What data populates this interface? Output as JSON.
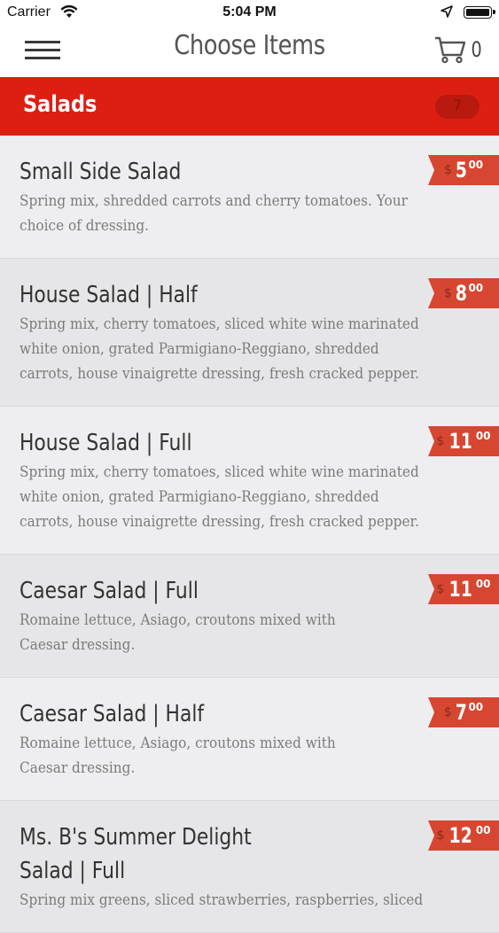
{
  "status": {
    "carrier": "Carrier",
    "time": "5:04 PM"
  },
  "nav": {
    "title": "Choose Items",
    "cart_count": "0"
  },
  "category": {
    "title": "Salads",
    "count": "7"
  },
  "currency": "$",
  "items": [
    {
      "name": "Small Side Salad",
      "desc": "Spring mix, shredded carrots and cherry tomatoes. Your choice of dressing.",
      "price_dollars": "5",
      "price_cents": "00"
    },
    {
      "name": "House Salad | Half",
      "desc": "Spring mix, cherry tomatoes, sliced white wine marinated white onion, grated Parmigiano-Reggiano, shredded carrots, house vinaigrette dressing, fresh cracked pepper.",
      "price_dollars": "8",
      "price_cents": "00"
    },
    {
      "name": "House Salad | Full",
      "desc": "Spring mix, cherry tomatoes, sliced white wine marinated white onion, grated Parmigiano-Reggiano, shredded carrots, house vinaigrette dressing, fresh cracked pepper.",
      "price_dollars": "11",
      "price_cents": "00"
    },
    {
      "name": "Caesar Salad | Full",
      "desc": "Romaine lettuce, Asiago, croutons mixed with Caesar dressing.",
      "price_dollars": "11",
      "price_cents": "00"
    },
    {
      "name": "Caesar Salad | Half",
      "desc": "Romaine lettuce, Asiago, croutons mixed with Caesar dressing.",
      "price_dollars": "7",
      "price_cents": "00"
    },
    {
      "name": "Ms. B's Summer Delight Salad | Full",
      "desc": "Spring mix greens, sliced strawberries, raspberries, sliced",
      "price_dollars": "12",
      "price_cents": "00"
    }
  ]
}
